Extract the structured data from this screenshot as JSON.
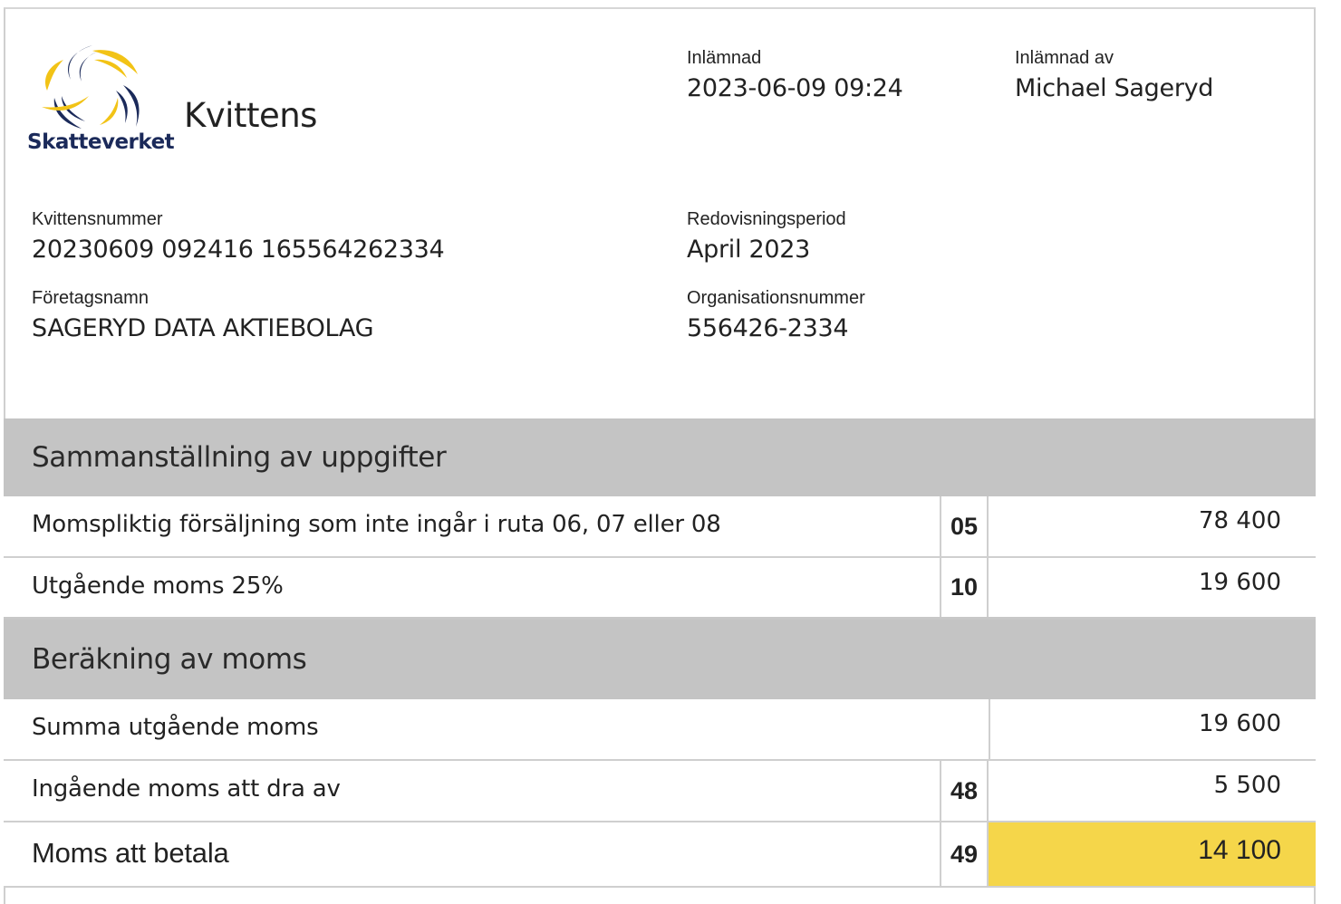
{
  "header": {
    "logo_text": "Skatteverket",
    "title": "Kvittens"
  },
  "submitted": {
    "label": "Inlämnad",
    "value": "2023-06-09 09:24"
  },
  "submitted_by": {
    "label": "Inlämnad av",
    "value": "Michael Sageryd"
  },
  "receipt_number": {
    "label": "Kvittensnummer",
    "value": "20230609 092416 165564262334"
  },
  "reporting_period": {
    "label": "Redovisningsperiod",
    "value": "April 2023"
  },
  "company_name": {
    "label": "Företagsnamn",
    "value": "SAGERYD DATA AKTIEBOLAG"
  },
  "org_number": {
    "label": "Organisationsnummer",
    "value": "556426-2334"
  },
  "section1": {
    "title": "Sammanställning av uppgifter",
    "rows": [
      {
        "desc": "Momspliktig försäljning som inte ingår i ruta 06, 07 eller 08",
        "box": "05",
        "amount": "78 400"
      },
      {
        "desc": "Utgående moms 25%",
        "box": "10",
        "amount": "19 600"
      }
    ]
  },
  "section2": {
    "title": "Beräkning av moms",
    "rows": [
      {
        "desc": "Summa utgående moms",
        "box": "",
        "amount": "19 600"
      },
      {
        "desc": "Ingående moms att dra av",
        "box": "48",
        "amount": "5 500"
      },
      {
        "desc": "Moms att betala",
        "box": "49",
        "amount": "14 100"
      }
    ]
  },
  "colors": {
    "brand_navy": "#1b2a5a",
    "brand_yellow": "#f2c316",
    "highlight": "#f5d64a",
    "section_bg": "#c4c4c4"
  },
  "icons": {
    "logo": "skatteverket-swirl-logo"
  }
}
